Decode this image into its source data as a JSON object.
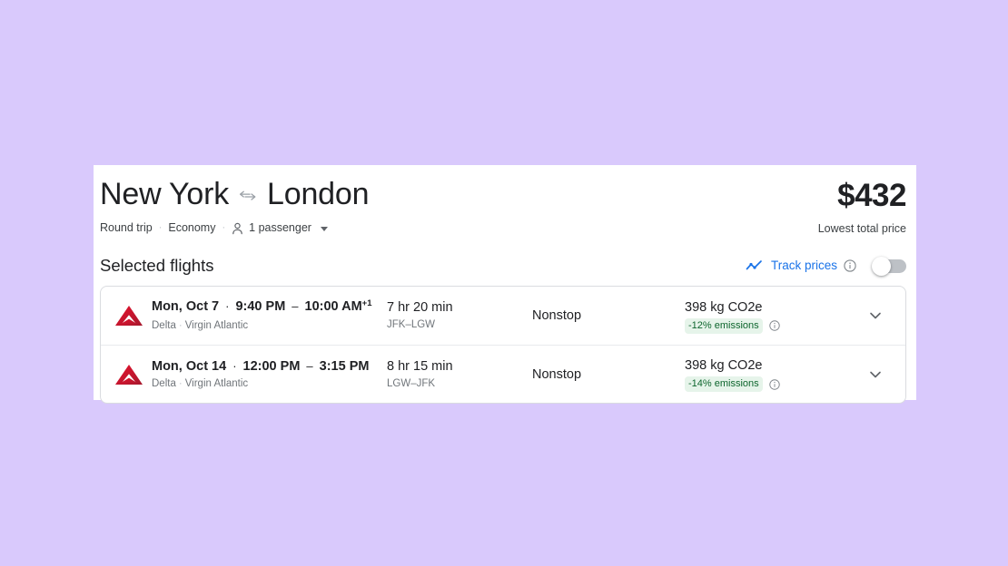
{
  "background_color": "#d9c9fc",
  "header": {
    "origin": "New York",
    "destination": "London",
    "swap_icon": "swap-horizontal-arrows-icon",
    "trip_type": "Round trip",
    "separator": "·",
    "cabin_class": "Economy",
    "passenger_icon": "person-icon",
    "passengers": "1 passenger",
    "passenger_dropdown_icon": "caret-down-icon",
    "price": "$432",
    "price_caption": "Lowest total price"
  },
  "selected_flights": {
    "title": "Selected flights",
    "track_prices": {
      "chart_icon": "line-chart-trend-icon",
      "label": "Track prices",
      "info_icon": "info-circle-icon",
      "toggle_state": "off",
      "accent_color": "#1a73e8"
    }
  },
  "flights": [
    {
      "airline_logo": "delta-airlines-logo",
      "date": "Mon, Oct 7",
      "date_separator": "·",
      "departure_time": "9:40 PM",
      "time_dash": "–",
      "arrival_time": "10:00 AM",
      "arrival_day_offset": "+1",
      "operators": "Delta",
      "operators_sep": "·",
      "operators_second": "Virgin Atlantic",
      "duration": "7 hr 20 min",
      "airports": "JFK–LGW",
      "stops": "Nonstop",
      "emissions": "398 kg CO2e",
      "emissions_delta": "-12% emissions",
      "emissions_info_icon": "info-circle-icon",
      "expand_icon": "chevron-down-icon"
    },
    {
      "airline_logo": "delta-airlines-logo",
      "date": "Mon, Oct 14",
      "date_separator": "·",
      "departure_time": "12:00 PM",
      "time_dash": "–",
      "arrival_time": "3:15 PM",
      "arrival_day_offset": "",
      "operators": "Delta",
      "operators_sep": "·",
      "operators_second": "Virgin Atlantic",
      "duration": "8 hr 15 min",
      "airports": "LGW–JFK",
      "stops": "Nonstop",
      "emissions": "398 kg CO2e",
      "emissions_delta": "-14% emissions",
      "emissions_info_icon": "info-circle-icon",
      "expand_icon": "chevron-down-icon"
    }
  ]
}
